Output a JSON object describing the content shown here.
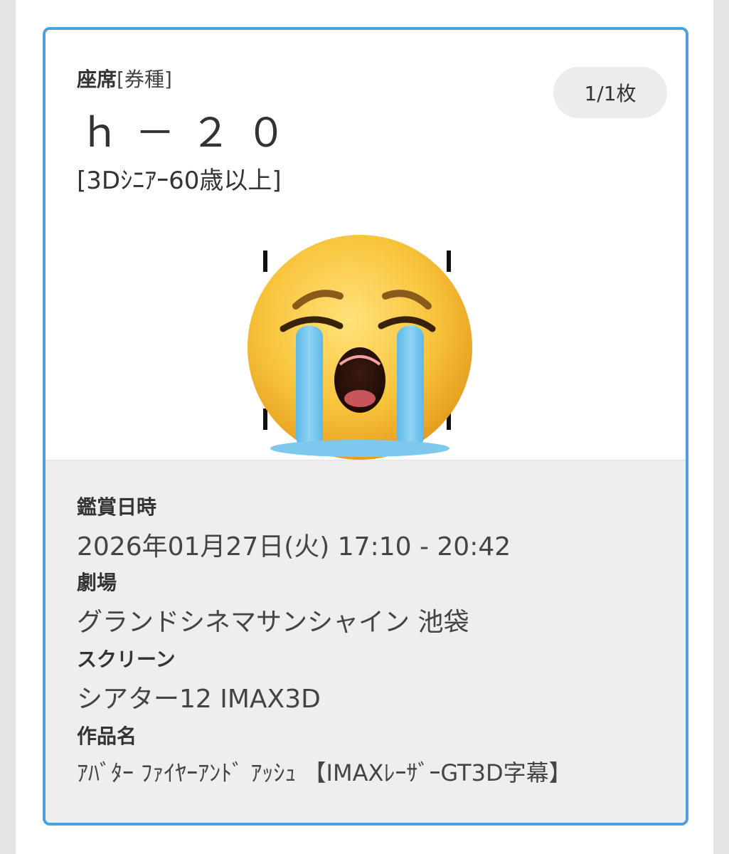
{
  "seat": {
    "label_bold": "座席",
    "label_light": "[券種]",
    "value": "ｈ－２０",
    "ticket_type": "[3Dｼﾆｱｰ60歳以上]",
    "count": "1/1枚"
  },
  "emoji": {
    "icon": "loudly-crying-face-icon"
  },
  "details": {
    "datetime_label": "鑑賞日時",
    "datetime_value": "2026年01月27日(火) 17:10 - 20:42",
    "theater_label": "劇場",
    "theater_value": "グランドシネマサンシャイン 池袋",
    "screen_label": "スクリーン",
    "screen_value": "シアター12 IMAX3D",
    "title_label": "作品名",
    "title_value": "ｱﾊﾞﾀｰ ﾌｧｲﾔｰｱﾝﾄﾞ ｱｯｼｭ 【IMAXﾚｰｻﾞｰGT3D字幕】"
  },
  "colors": {
    "card_border": "#4f9fd8",
    "info_background": "#eeeeee",
    "badge_background": "#ececec"
  }
}
